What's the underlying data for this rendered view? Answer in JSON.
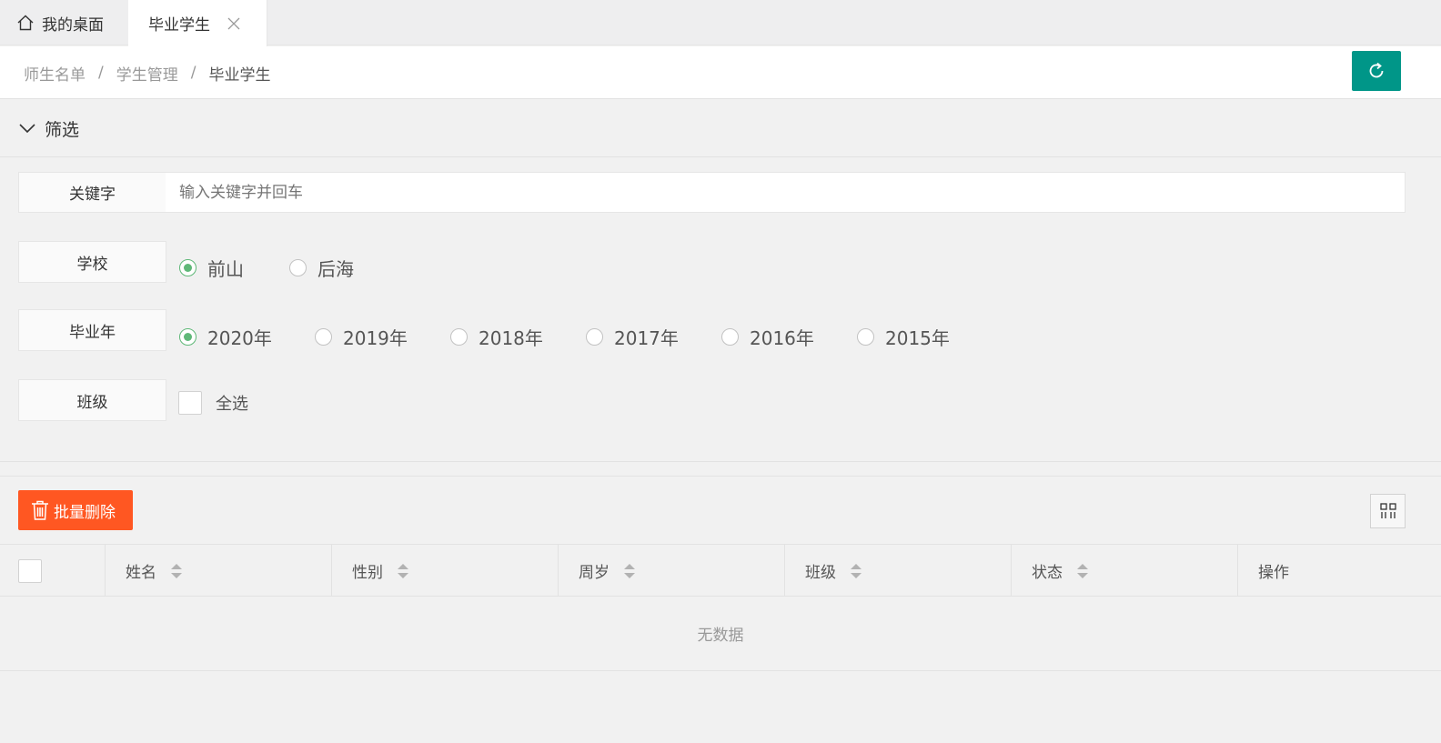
{
  "tabs": {
    "home_label": "我的桌面",
    "active_label": "毕业学生"
  },
  "breadcrumb": {
    "items": [
      "师生名单",
      "学生管理",
      "毕业学生"
    ],
    "separator": "/"
  },
  "filter": {
    "title": "筛选",
    "keyword": {
      "label": "关键字",
      "placeholder": "输入关键字并回车",
      "value": ""
    },
    "school": {
      "label": "学校",
      "options": [
        "前山",
        "后海"
      ],
      "selected": "前山"
    },
    "year": {
      "label": "毕业年",
      "options": [
        "2020年",
        "2019年",
        "2018年",
        "2017年",
        "2016年",
        "2015年"
      ],
      "selected": "2020年"
    },
    "class": {
      "label": "班级",
      "select_all_label": "全选",
      "checked": false
    }
  },
  "toolbar": {
    "batch_delete_label": "批量删除"
  },
  "table": {
    "columns": [
      "姓名",
      "性别",
      "周岁",
      "班级",
      "状态",
      "操作"
    ],
    "empty_text": "无数据"
  },
  "colors": {
    "primary": "#009688",
    "danger": "#ff5722",
    "radio_checked": "#5fb878"
  }
}
